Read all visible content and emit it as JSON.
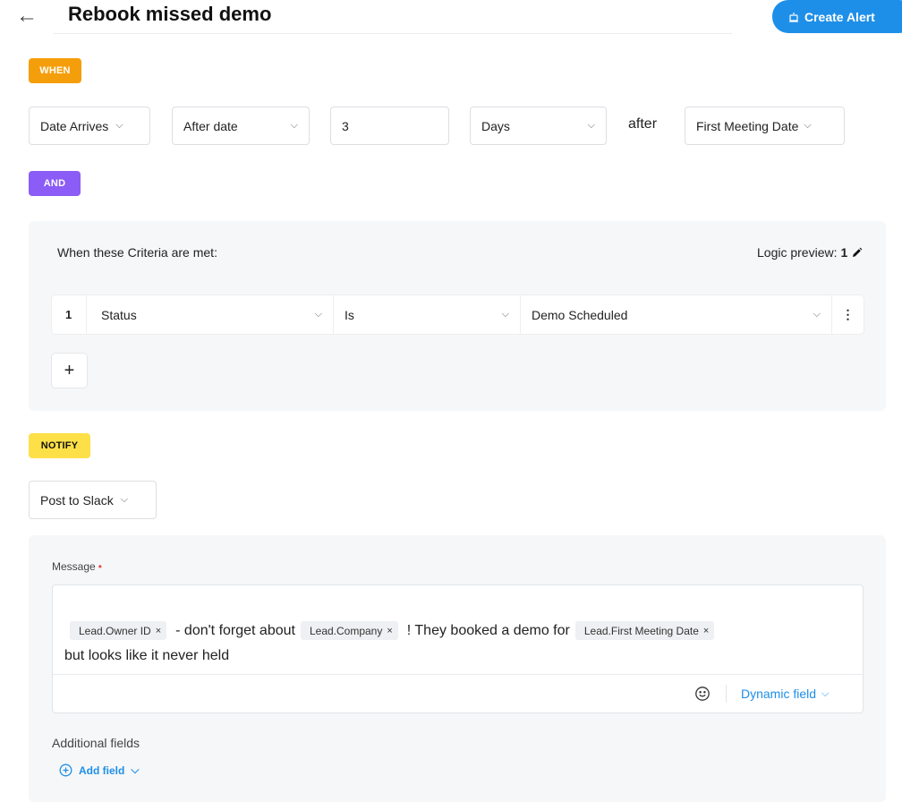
{
  "header": {
    "back_icon": "←",
    "title": "Rebook missed demo",
    "create_alert_label": "Create Alert"
  },
  "badges": {
    "when": "WHEN",
    "and": "AND",
    "notify": "NOTIFY"
  },
  "trigger": {
    "event": "Date Arrives",
    "relation": "After date",
    "amount": "3",
    "unit": "Days",
    "connector": "after",
    "date_field": "First Meeting Date"
  },
  "criteria": {
    "title": "When these Criteria are met:",
    "logic_preview_label": "Logic preview:",
    "logic_preview_value": "1",
    "rows": [
      {
        "index": "1",
        "field": "Status",
        "operator": "Is",
        "value": "Demo Scheduled",
        "menu": "⋮"
      }
    ],
    "add_label": "+"
  },
  "notify": {
    "channel": "Post to Slack",
    "message_label": "Message",
    "required_mark": "•",
    "message": {
      "chip_owner": "Lead.Owner ID",
      "text1": "- don't forget about",
      "chip_company": "Lead.Company",
      "text2": "! They booked a demo for",
      "chip_meeting": "Lead.First Meeting Date",
      "text3": "but looks like it never held",
      "chip_remove": "×"
    },
    "dynamic_field_label": "Dynamic field",
    "additional_fields_label": "Additional fields",
    "add_field_label": "Add field"
  },
  "icons": {
    "chevron": "⌄",
    "chevron_small": "⌵",
    "edit": "pencil-icon",
    "emoji": "smiley-icon",
    "alert": "alarm-icon",
    "plus_circle": "plus-circle-icon"
  },
  "colors": {
    "accent": "#1e8fe8",
    "when_badge": "#f59e0b",
    "and_badge": "#8b5cf6",
    "notify_badge": "#fde047",
    "required": "#ef4444"
  }
}
